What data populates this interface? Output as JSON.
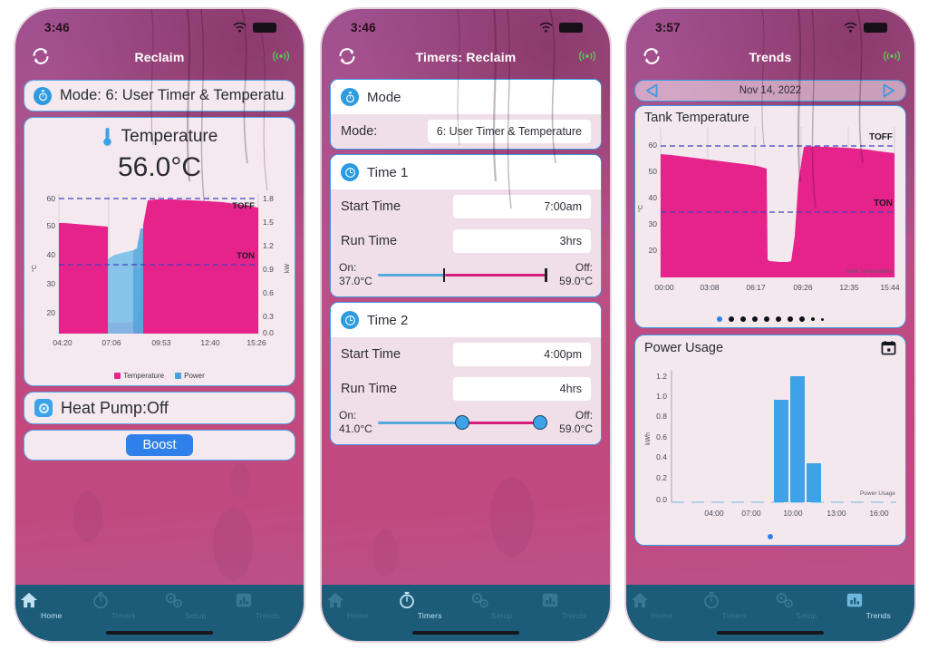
{
  "meta": {
    "accent_blue": "#3d9ae0",
    "accent_pink": "#e6228b",
    "tabbar_bg": "#1d5c79"
  },
  "phone1": {
    "status": {
      "time": "3:46",
      "wifi_icon": "wifi-icon",
      "battery_icon": "battery-icon"
    },
    "nav": {
      "title": "Reclaim",
      "refresh_icon": "refresh-icon",
      "signal_icon": "broadcast-icon"
    },
    "mode_bar": {
      "icon": "stopwatch-icon",
      "text": "Mode: 6: User Timer & Temperatu..."
    },
    "temperature_card": {
      "icon": "thermometer-icon",
      "label": "Temperature",
      "value": "56.0°C"
    },
    "heat_pump": {
      "icon": "gear-icon",
      "text": "Heat Pump:Off"
    },
    "boost": {
      "label": "Boost"
    },
    "tabs": [
      {
        "label": "Home",
        "icon": "home-icon",
        "active": true
      },
      {
        "label": "Timers",
        "icon": "stopwatch-icon",
        "active": false
      },
      {
        "label": "Setup",
        "icon": "gears-icon",
        "active": false
      },
      {
        "label": "Trends",
        "icon": "chart-icon",
        "active": false
      }
    ]
  },
  "phone2": {
    "status": {
      "time": "3:46",
      "wifi_icon": "wifi-icon",
      "battery_icon": "battery-icon"
    },
    "nav": {
      "title": "Timers: Reclaim",
      "refresh_icon": "refresh-icon",
      "signal_icon": "broadcast-icon"
    },
    "sections": [
      {
        "header": "Mode",
        "header_icon": "stopwatch-icon",
        "rows": [
          {
            "label": "Mode:",
            "value": "6: User Timer & Temperature"
          }
        ],
        "slider": null
      },
      {
        "header": "Time 1",
        "header_icon": "clock-icon",
        "rows": [
          {
            "label": "Start Time",
            "value": "7:00am"
          },
          {
            "label": "Run Time",
            "value": "3hrs"
          }
        ],
        "slider": {
          "on_label": "On:",
          "on_value": "37.0°C",
          "off_label": "Off:",
          "off_value": "59.0°C",
          "thumb_style": "bar",
          "left_pct": 38,
          "right_pct": 92
        }
      },
      {
        "header": "Time 2",
        "header_icon": "clock-icon",
        "rows": [
          {
            "label": "Start Time",
            "value": "4:00pm"
          },
          {
            "label": "Run Time",
            "value": "4hrs"
          }
        ],
        "slider": {
          "on_label": "On:",
          "on_value": "41.0°C",
          "off_label": "Off:",
          "off_value": "59.0°C",
          "thumb_style": "dot",
          "left_pct": 48,
          "right_pct": 88
        }
      }
    ],
    "tabs": [
      {
        "label": "Home",
        "icon": "home-icon",
        "active": false
      },
      {
        "label": "Timers",
        "icon": "stopwatch-icon",
        "active": true
      },
      {
        "label": "Setup",
        "icon": "gears-icon",
        "active": false
      },
      {
        "label": "Trends",
        "icon": "chart-icon",
        "active": false
      }
    ]
  },
  "phone3": {
    "status": {
      "time": "3:57",
      "wifi_icon": "wifi-icon",
      "battery_icon": "battery-icon"
    },
    "nav": {
      "title": "Trends",
      "refresh_icon": "refresh-icon",
      "signal_icon": "broadcast-icon"
    },
    "datebar": {
      "prev_icon": "triangle-left-icon",
      "date": "Nov 14, 2022",
      "next_icon": "triangle-right-icon"
    },
    "tank_card": {
      "title": "Tank Temperature",
      "dots_total": 10,
      "dots_active_index": 0
    },
    "power_card": {
      "title": "Power Usage",
      "calendar_icon": "calendar-icon",
      "dots_total": 1,
      "dots_active_index": 0
    },
    "tabs": [
      {
        "label": "Home",
        "icon": "home-icon",
        "active": false
      },
      {
        "label": "Timers",
        "icon": "stopwatch-icon",
        "active": false
      },
      {
        "label": "Setup",
        "icon": "gears-icon",
        "active": false
      },
      {
        "label": "Trends",
        "icon": "chart-icon",
        "active": true
      }
    ]
  },
  "chart_data": [
    {
      "id": "home_temperature_chart",
      "type": "area",
      "title": "Temperature",
      "xlabel": "",
      "ylabel": "°C",
      "y2label": "kW",
      "ylim": [
        12,
        62
      ],
      "y2lim": [
        0.0,
        1.8
      ],
      "yticks": [
        20,
        30,
        40,
        50,
        60
      ],
      "y2ticks": [
        0.0,
        0.3,
        0.6,
        0.9,
        1.2,
        1.5,
        1.8
      ],
      "xticks": [
        "04:20",
        "07:06",
        "09:53",
        "12:40",
        "15:26"
      ],
      "grid": true,
      "legend": [
        {
          "name": "Temperature",
          "color": "#e6228b"
        },
        {
          "name": "Power",
          "color": "#4aa3e0"
        }
      ],
      "annotations": [
        {
          "text": "TOFF",
          "y": 59.0,
          "style": "dashed",
          "color": "#4040c0"
        },
        {
          "text": "TON",
          "y": 37.0,
          "style": "dashed",
          "color": "#4040c0"
        }
      ],
      "series": [
        {
          "name": "Temperature",
          "color": "#e6228b",
          "x": [
            "04:20",
            "04:40",
            "05:00",
            "05:20",
            "05:40",
            "06:00",
            "06:20",
            "06:40",
            "07:00",
            "07:06",
            "07:20",
            "07:40",
            "08:00",
            "08:20",
            "08:40",
            "08:55",
            "09:05",
            "09:20",
            "09:40",
            "09:53",
            "10:20",
            "10:50",
            "11:20",
            "11:50",
            "12:20",
            "12:40",
            "13:10",
            "13:40",
            "14:10",
            "14:40",
            "15:10",
            "15:26"
          ],
          "values": [
            53.2,
            53.1,
            53.0,
            52.9,
            52.7,
            52.6,
            52.4,
            52.2,
            52.0,
            51.9,
            16.0,
            16.0,
            16.1,
            16.2,
            16.3,
            16.4,
            16.5,
            43.0,
            50.5,
            58.8,
            59.0,
            58.9,
            58.9,
            58.8,
            58.7,
            58.6,
            58.4,
            58.2,
            58.0,
            57.8,
            57.5,
            57.2
          ]
        },
        {
          "name": "Power",
          "color": "#4aa3e0",
          "x": [
            "07:06",
            "07:20",
            "07:40",
            "08:00",
            "08:20",
            "08:40",
            "08:55",
            "09:05",
            "09:20",
            "09:35",
            "09:53"
          ],
          "values": [
            0.0,
            1.22,
            1.24,
            1.26,
            1.28,
            1.3,
            1.31,
            1.4,
            1.45,
            0.0,
            0.0
          ]
        }
      ]
    },
    {
      "id": "tank_temperature_chart",
      "type": "area",
      "title": "Tank Temperature",
      "series_label": "Tank Temperature",
      "xlabel": "",
      "ylabel": "°C",
      "ylim": [
        14,
        64
      ],
      "yticks": [
        20,
        30,
        40,
        50,
        60
      ],
      "xticks": [
        "00:00",
        "03:08",
        "06:17",
        "09:26",
        "12:35",
        "15:44"
      ],
      "grid": true,
      "annotations": [
        {
          "text": "TOFF",
          "y": 59.0,
          "style": "dashed",
          "color": "#4040c0"
        },
        {
          "text": "TON",
          "y": 37.0,
          "style": "dashed",
          "color": "#4040c0"
        }
      ],
      "x": [
        "00:00",
        "00:40",
        "01:20",
        "02:00",
        "02:40",
        "03:08",
        "03:50",
        "04:30",
        "05:10",
        "05:50",
        "06:17",
        "06:45",
        "06:55",
        "07:10",
        "07:40",
        "08:10",
        "08:30",
        "08:45",
        "09:00",
        "09:26",
        "10:00",
        "10:40",
        "11:20",
        "12:00",
        "12:35",
        "13:10",
        "13:50",
        "14:30",
        "15:10",
        "15:44"
      ],
      "values": [
        56.5,
        56.2,
        55.9,
        55.5,
        55.0,
        54.6,
        54.1,
        53.6,
        53.1,
        52.6,
        52.0,
        51.2,
        17.0,
        16.3,
        16.2,
        16.2,
        16.5,
        40.0,
        55.0,
        59.0,
        59.0,
        58.9,
        58.8,
        58.6,
        58.5,
        58.2,
        57.9,
        57.6,
        57.2,
        56.6
      ]
    },
    {
      "id": "power_usage_chart",
      "type": "bar",
      "title": "Power Usage",
      "series_label": "Power Usage",
      "xlabel": "",
      "ylabel": "kWh",
      "ylim": [
        0.0,
        1.3
      ],
      "yticks": [
        0.0,
        0.2,
        0.4,
        0.6,
        0.8,
        1.0,
        1.2
      ],
      "xticks": [
        "04:00",
        "07:00",
        "10:00",
        "13:00",
        "16:00"
      ],
      "categories": [
        "09:00",
        "10:00",
        "11:00"
      ],
      "values": [
        0.99,
        1.2,
        0.38
      ],
      "bar_color": "#3da2e8",
      "grid": false
    }
  ]
}
